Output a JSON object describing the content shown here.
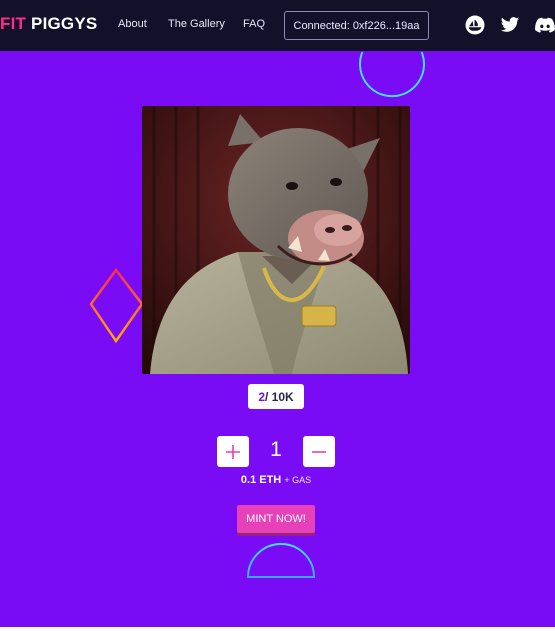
{
  "brand": {
    "part1": "FIT",
    "part2": "PIGGYS"
  },
  "nav": {
    "about": "About",
    "gallery": "The Gallery",
    "faq": "FAQ"
  },
  "wallet": {
    "label": "Connected: 0xf226...19aa"
  },
  "social": [
    "opensea-icon",
    "twitter-icon",
    "discord-icon"
  ],
  "mint": {
    "minted": "2",
    "supply": " / 10K",
    "quantity": "1",
    "price": "0.1 ETH",
    "gas": "+ GAS",
    "button_label": "MINT NOW!"
  },
  "colors": {
    "background": "#7a0cf5",
    "navbar": "#13112a",
    "accent_pink": "#e641b9",
    "accent_cyan": "#3de1e6",
    "brand_pink": "#ff2d8f"
  }
}
